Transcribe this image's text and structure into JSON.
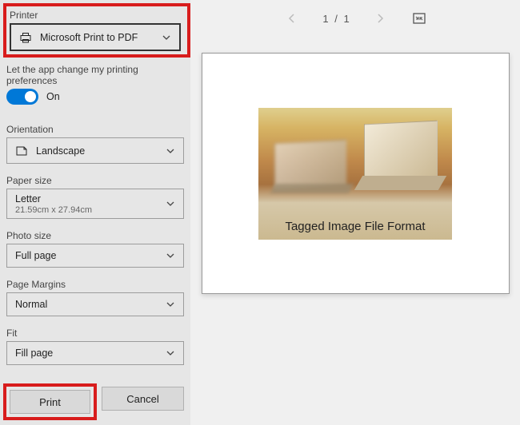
{
  "sidebar": {
    "printer": {
      "label": "Printer",
      "value": "Microsoft Print to PDF"
    },
    "appPrefs": {
      "label": "Let the app change my printing preferences",
      "state": "On",
      "on": true
    },
    "orientation": {
      "label": "Orientation",
      "value": "Landscape"
    },
    "paperSize": {
      "label": "Paper size",
      "value": "Letter",
      "sub": "21.59cm x 27.94cm"
    },
    "photoSize": {
      "label": "Photo size",
      "value": "Full page"
    },
    "margins": {
      "label": "Page Margins",
      "value": "Normal"
    },
    "fit": {
      "label": "Fit",
      "value": "Fill page"
    },
    "buttons": {
      "print": "Print",
      "cancel": "Cancel"
    }
  },
  "pager": {
    "current": 1,
    "total": 1,
    "separator": "/"
  },
  "preview": {
    "caption": "Tagged Image File Format"
  }
}
